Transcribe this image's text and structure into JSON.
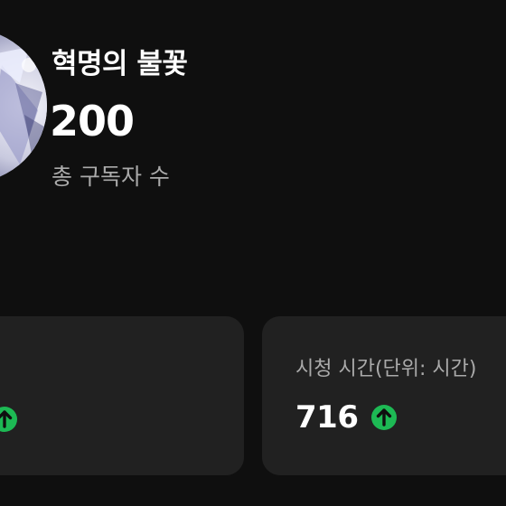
{
  "channel": {
    "name": "혁명의 불꽃",
    "subscriber_count": "200",
    "subscriber_label": "총 구독자 수"
  },
  "stats": {
    "left_card": {
      "trend_icon": "arrow-up-circle-icon",
      "trend_color": "#1db954"
    },
    "right_card": {
      "title": "시청 시간(단위: 시간)",
      "value": "716",
      "trend_icon": "arrow-up-circle-icon",
      "trend_color": "#1db954"
    }
  },
  "colors": {
    "background": "#0f0f0f",
    "card": "#212121",
    "primary_text": "#ffffff",
    "secondary_text": "#aaaaaa",
    "trend_up": "#1db954"
  }
}
